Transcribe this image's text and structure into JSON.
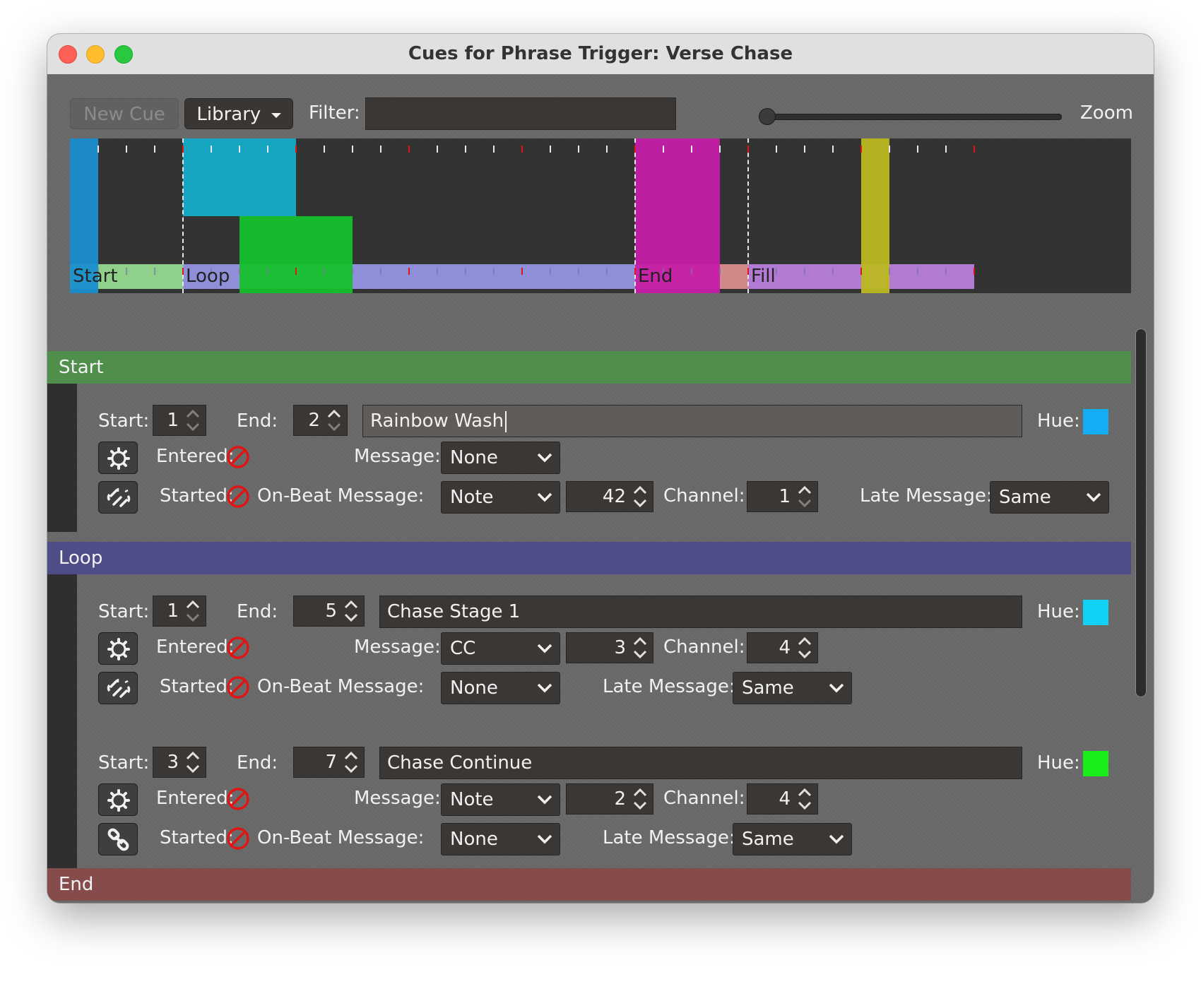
{
  "window": {
    "title": "Cues for Phrase Trigger: Verse Chase"
  },
  "toolbar": {
    "new_cue_label": "New Cue",
    "library_label": "Library",
    "filter_label": "Filter:",
    "filter_value": "",
    "zoom_label": "Zoom",
    "zoom_level": 0
  },
  "timeline": {
    "section_labels": [
      "Start",
      "Loop",
      "End",
      "Fill"
    ],
    "section_colors": {
      "start": "#8fd08a",
      "loop": "#8f8ed8",
      "end": "#d08888",
      "fill": "#b27ad2"
    },
    "cue_colors": [
      "#1a8fd0",
      "#16a6c2",
      "#15c12c",
      "#c61da9",
      "#bcb920"
    ]
  },
  "sections": {
    "start": {
      "label": "Start",
      "color": "#4f8e4b"
    },
    "loop": {
      "label": "Loop",
      "color": "#4f4d88"
    },
    "end": {
      "label": "End",
      "color": "#864c4c"
    }
  },
  "labels": {
    "start": "Start:",
    "end": "End:",
    "hue": "Hue:",
    "entered": "Entered:",
    "started": "Started:",
    "message": "Message:",
    "on_beat_message": "On-Beat Message:",
    "channel": "Channel:",
    "late_message": "Late Message:"
  },
  "cues": [
    {
      "start": "1",
      "end": "2",
      "name": "Rainbow Wash",
      "hue": "#13aef5",
      "entered_message": "None",
      "on_beat_message": "Note",
      "on_beat_note": "42",
      "on_beat_channel": "1",
      "late_message": "Same"
    },
    {
      "start": "1",
      "end": "5",
      "name": "Chase Stage 1",
      "hue": "#11d2f6",
      "entered_message": "CC",
      "entered_note": "3",
      "entered_channel": "4",
      "on_beat_message": "None",
      "late_message": "Same"
    },
    {
      "start": "3",
      "end": "7",
      "name": "Chase Continue",
      "hue": "#18ee18",
      "entered_message": "Note",
      "entered_note": "2",
      "entered_channel": "4",
      "on_beat_message": "None",
      "late_message": "Same"
    }
  ]
}
